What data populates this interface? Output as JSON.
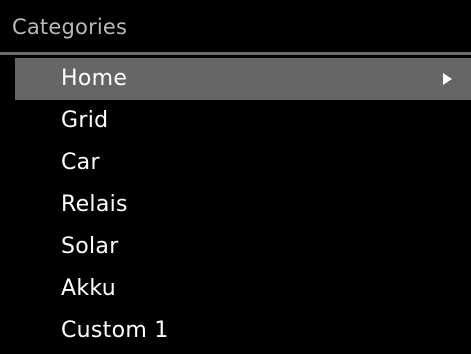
{
  "header": {
    "title": "Categories"
  },
  "menu": {
    "items": [
      {
        "label": "Home",
        "selected": true,
        "icon": "arrow-right-icon"
      },
      {
        "label": "Grid"
      },
      {
        "label": "Car"
      },
      {
        "label": "Relais"
      },
      {
        "label": "Solar"
      },
      {
        "label": "Akku"
      },
      {
        "label": "Custom 1"
      }
    ]
  },
  "colors": {
    "background": "#000000",
    "header_text": "#b8b8b8",
    "divider": "#6a6a6a",
    "selection": "#666666",
    "item_text": "#ffffff"
  }
}
